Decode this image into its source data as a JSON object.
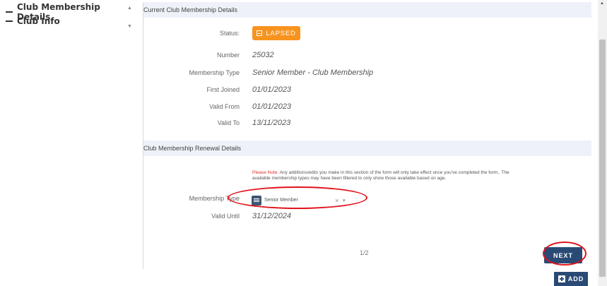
{
  "nav": {
    "items": [
      {
        "label": "Club Membership Details"
      },
      {
        "label": "Club Info"
      }
    ]
  },
  "current_section": {
    "title": "Current Club Membership Details",
    "status_label": "Status:",
    "status_value": "LAPSED",
    "status_color": "#f7931e",
    "number_label": "Number",
    "number_value": "25032",
    "type_label": "Membership Type",
    "type_value": "Senior Member - Club Membership",
    "first_joined_label": "First Joined",
    "first_joined_value": "01/01/2023",
    "valid_from_label": "Valid From",
    "valid_from_value": "01/01/2023",
    "valid_to_label": "Valid To",
    "valid_to_value": "13/11/2023"
  },
  "renewal_section": {
    "title": "Club Membership Renewal Details",
    "note_prefix": "Please Note:",
    "note_text": " Any additions/edits you make in this section of the form will only take effect once you've completed the form.. The available membership types may have been filtered to only show those available based on age.",
    "type_label": "Membership Type",
    "type_value": "Senior Member",
    "valid_until_label": "Valid Until",
    "valid_until_value": "31/12/2024"
  },
  "pagination": {
    "indicator": "1/2"
  },
  "buttons": {
    "next_label": "NEXT",
    "add_label": "ADD"
  },
  "colors": {
    "primary": "#294a74",
    "annotation": "#e0131b",
    "note_red": "#d9332b"
  }
}
